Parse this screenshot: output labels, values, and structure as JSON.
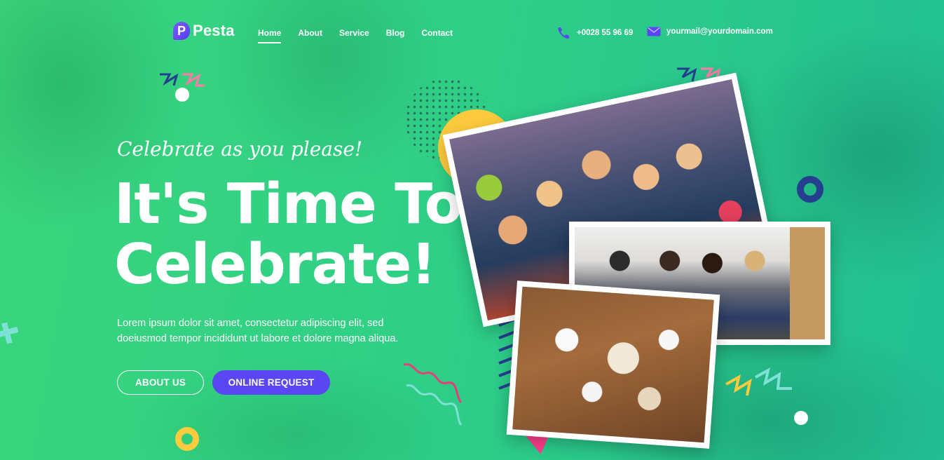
{
  "brand": {
    "logo_letter": "P",
    "name": "Pesta"
  },
  "nav": {
    "items": [
      {
        "label": "Home",
        "active": true
      },
      {
        "label": "About",
        "active": false
      },
      {
        "label": "Service",
        "active": false
      },
      {
        "label": "Blog",
        "active": false
      },
      {
        "label": "Contact",
        "active": false
      }
    ]
  },
  "contact": {
    "phone": "+0028 55 96 69",
    "email": "yourmail@yourdomain.com",
    "phone_icon": "phone-icon",
    "email_icon": "envelope-icon"
  },
  "hero": {
    "tagline": "Celebrate as you please!",
    "headline_line1": "It's Time To",
    "headline_line2": "Celebrate!",
    "lead": "Lorem ipsum dolor sit amet, consectetur adipiscing elit, sed doeiusmod tempor incididunt ut labore et dolore magna aliqua.",
    "button_primary": "ABOUT US",
    "button_secondary": "ONLINE REQUEST"
  },
  "colors": {
    "accent": "#5b46f3",
    "background_start": "#3ad67c",
    "background_end": "#22bf93",
    "deco_yellow": "#ffcb3e",
    "deco_navy": "#253e8e",
    "deco_pink": "#ff3f8e",
    "deco_teal": "#7fe1d6"
  }
}
